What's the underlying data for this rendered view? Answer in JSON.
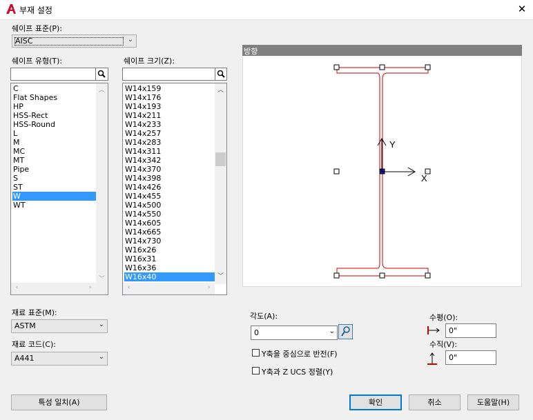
{
  "window": {
    "title": "부재 설정",
    "close_label": "✕"
  },
  "shape_standard": {
    "label": "쉐이프 표준(P):",
    "value": "AISC"
  },
  "shape_type": {
    "label": "쉐이프 유형(T):",
    "items": [
      "C",
      "Flat Shapes",
      "HP",
      "HSS-Rect",
      "HSS-Round",
      "L",
      "M",
      "MC",
      "MT",
      "Pipe",
      "S",
      "ST",
      "W",
      "WT"
    ],
    "selected": "W"
  },
  "shape_size": {
    "label": "쉐이프 크기(Z):",
    "items": [
      "W14x159",
      "W14x176",
      "W14x193",
      "W14x211",
      "W14x233",
      "W14x257",
      "W14x283",
      "W14x311",
      "W14x342",
      "W14x370",
      "W14x398",
      "W14x426",
      "W14x455",
      "W14x500",
      "W14x550",
      "W14x605",
      "W14x665",
      "W14x730",
      "W16x26",
      "W16x31",
      "W16x36",
      "W16x40"
    ],
    "selected": "W16x40"
  },
  "preview": {
    "header": "방향",
    "y_axis": "Y",
    "x_axis": "X"
  },
  "material_standard": {
    "label": "재료 표준(M):",
    "value": "ASTM"
  },
  "material_code": {
    "label": "재료 코드(C):",
    "value": "A441"
  },
  "angle": {
    "label": "각도(A):",
    "value": "0"
  },
  "mirror_y": {
    "label": "Y축을 중심으로 반전(F)",
    "checked": false
  },
  "align_y_ucs": {
    "label": "Y축과 Z UCS 정렬(Y)",
    "checked": false
  },
  "horizontal": {
    "label": "수평(O):",
    "value": "0\""
  },
  "vertical": {
    "label": "수직(V):",
    "value": "0\""
  },
  "buttons": {
    "match": "특성 일치(A)",
    "ok": "확인",
    "cancel": "취소",
    "help": "도움말(H)"
  },
  "colors": {
    "accent": "#0078d7",
    "selection": "#3399ff",
    "profile": "#cc0000",
    "app_icon": "#c8102e"
  }
}
